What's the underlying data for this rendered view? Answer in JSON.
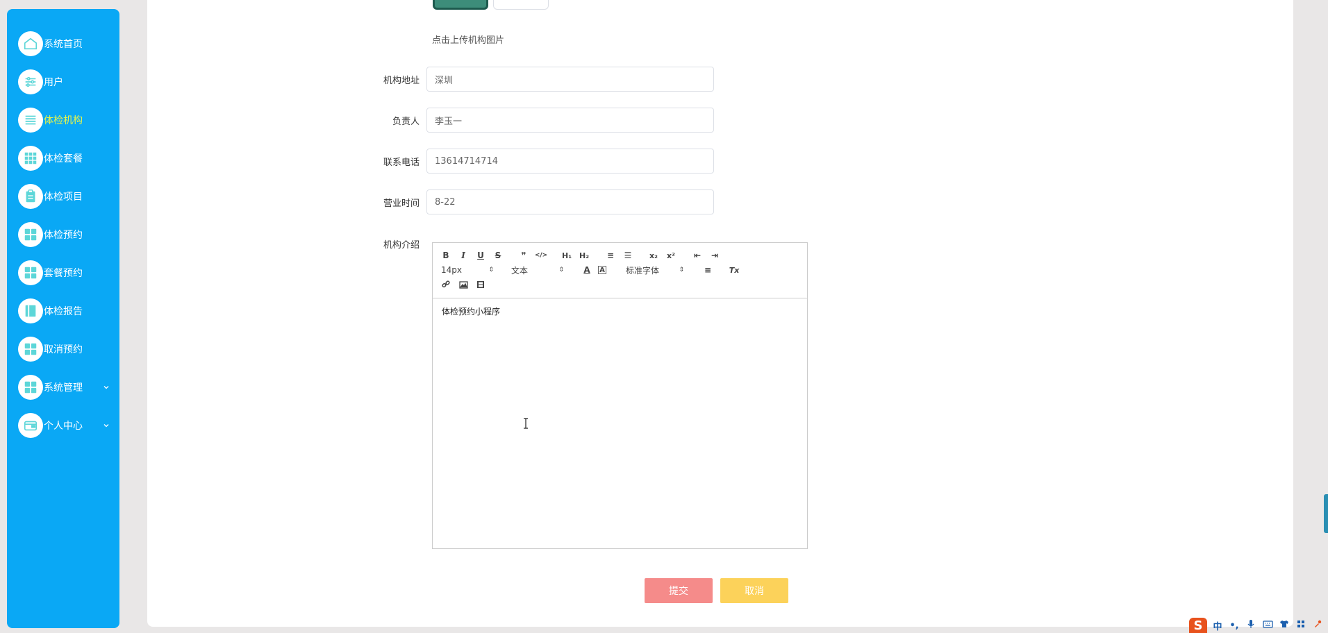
{
  "sidebar": {
    "items": [
      {
        "label": "系统首页",
        "icon": "home-icon"
      },
      {
        "label": "用户",
        "icon": "sliders-icon"
      },
      {
        "label": "体检机构",
        "icon": "list-icon",
        "active": true
      },
      {
        "label": "体检套餐",
        "icon": "grid-nine-icon"
      },
      {
        "label": "体检项目",
        "icon": "clipboard-icon"
      },
      {
        "label": "体检预约",
        "icon": "grid-four-icon"
      },
      {
        "label": "套餐预约",
        "icon": "grid-four-icon"
      },
      {
        "label": "体检报告",
        "icon": "book-icon"
      },
      {
        "label": "取消预约",
        "icon": "grid-four-icon"
      },
      {
        "label": "系统管理",
        "icon": "grid-four-icon",
        "expandable": true
      },
      {
        "label": "个人中心",
        "icon": "wallet-icon",
        "expandable": true
      }
    ],
    "active_color": "#e8f54a",
    "bg_color": "#0aa8f5"
  },
  "form": {
    "upload_hint": "点击上传机构图片",
    "fields": [
      {
        "label": "机构地址",
        "value": "深圳"
      },
      {
        "label": "负责人",
        "value": "李玉一"
      },
      {
        "label": "联系电话",
        "value": "13614714714"
      },
      {
        "label": "营业时间",
        "value": "8-22"
      }
    ],
    "editor": {
      "label": "机构介绍",
      "toolbar": {
        "bold": "B",
        "italic": "I",
        "underline": "U",
        "strike": "S",
        "blockquote": "❞",
        "code": "</>",
        "h1": "H₁",
        "h2": "H₂",
        "ordered_list": "≡",
        "bullet_list": "☰",
        "subscript": "x₂",
        "superscript": "x²",
        "outdent": "⇤",
        "indent": "⇥",
        "size": "14px",
        "header": "文本",
        "color": "A",
        "background": "A",
        "font": "标准字体",
        "align": "≡",
        "clean": "Tx",
        "link": "🔗",
        "image": "▣",
        "video": "▤"
      },
      "content": "体检预约小程序"
    },
    "submit_label": "提交",
    "cancel_label": "取消"
  },
  "colors": {
    "submit": "#f58b8a",
    "cancel": "#fcd25a"
  },
  "tray": {
    "ime_logo": "S",
    "ime_lang": "中",
    "punct": "•,",
    "icons": [
      "mic-icon",
      "keyboard-icon",
      "shirt-icon",
      "apps-icon",
      "tool-icon"
    ]
  }
}
